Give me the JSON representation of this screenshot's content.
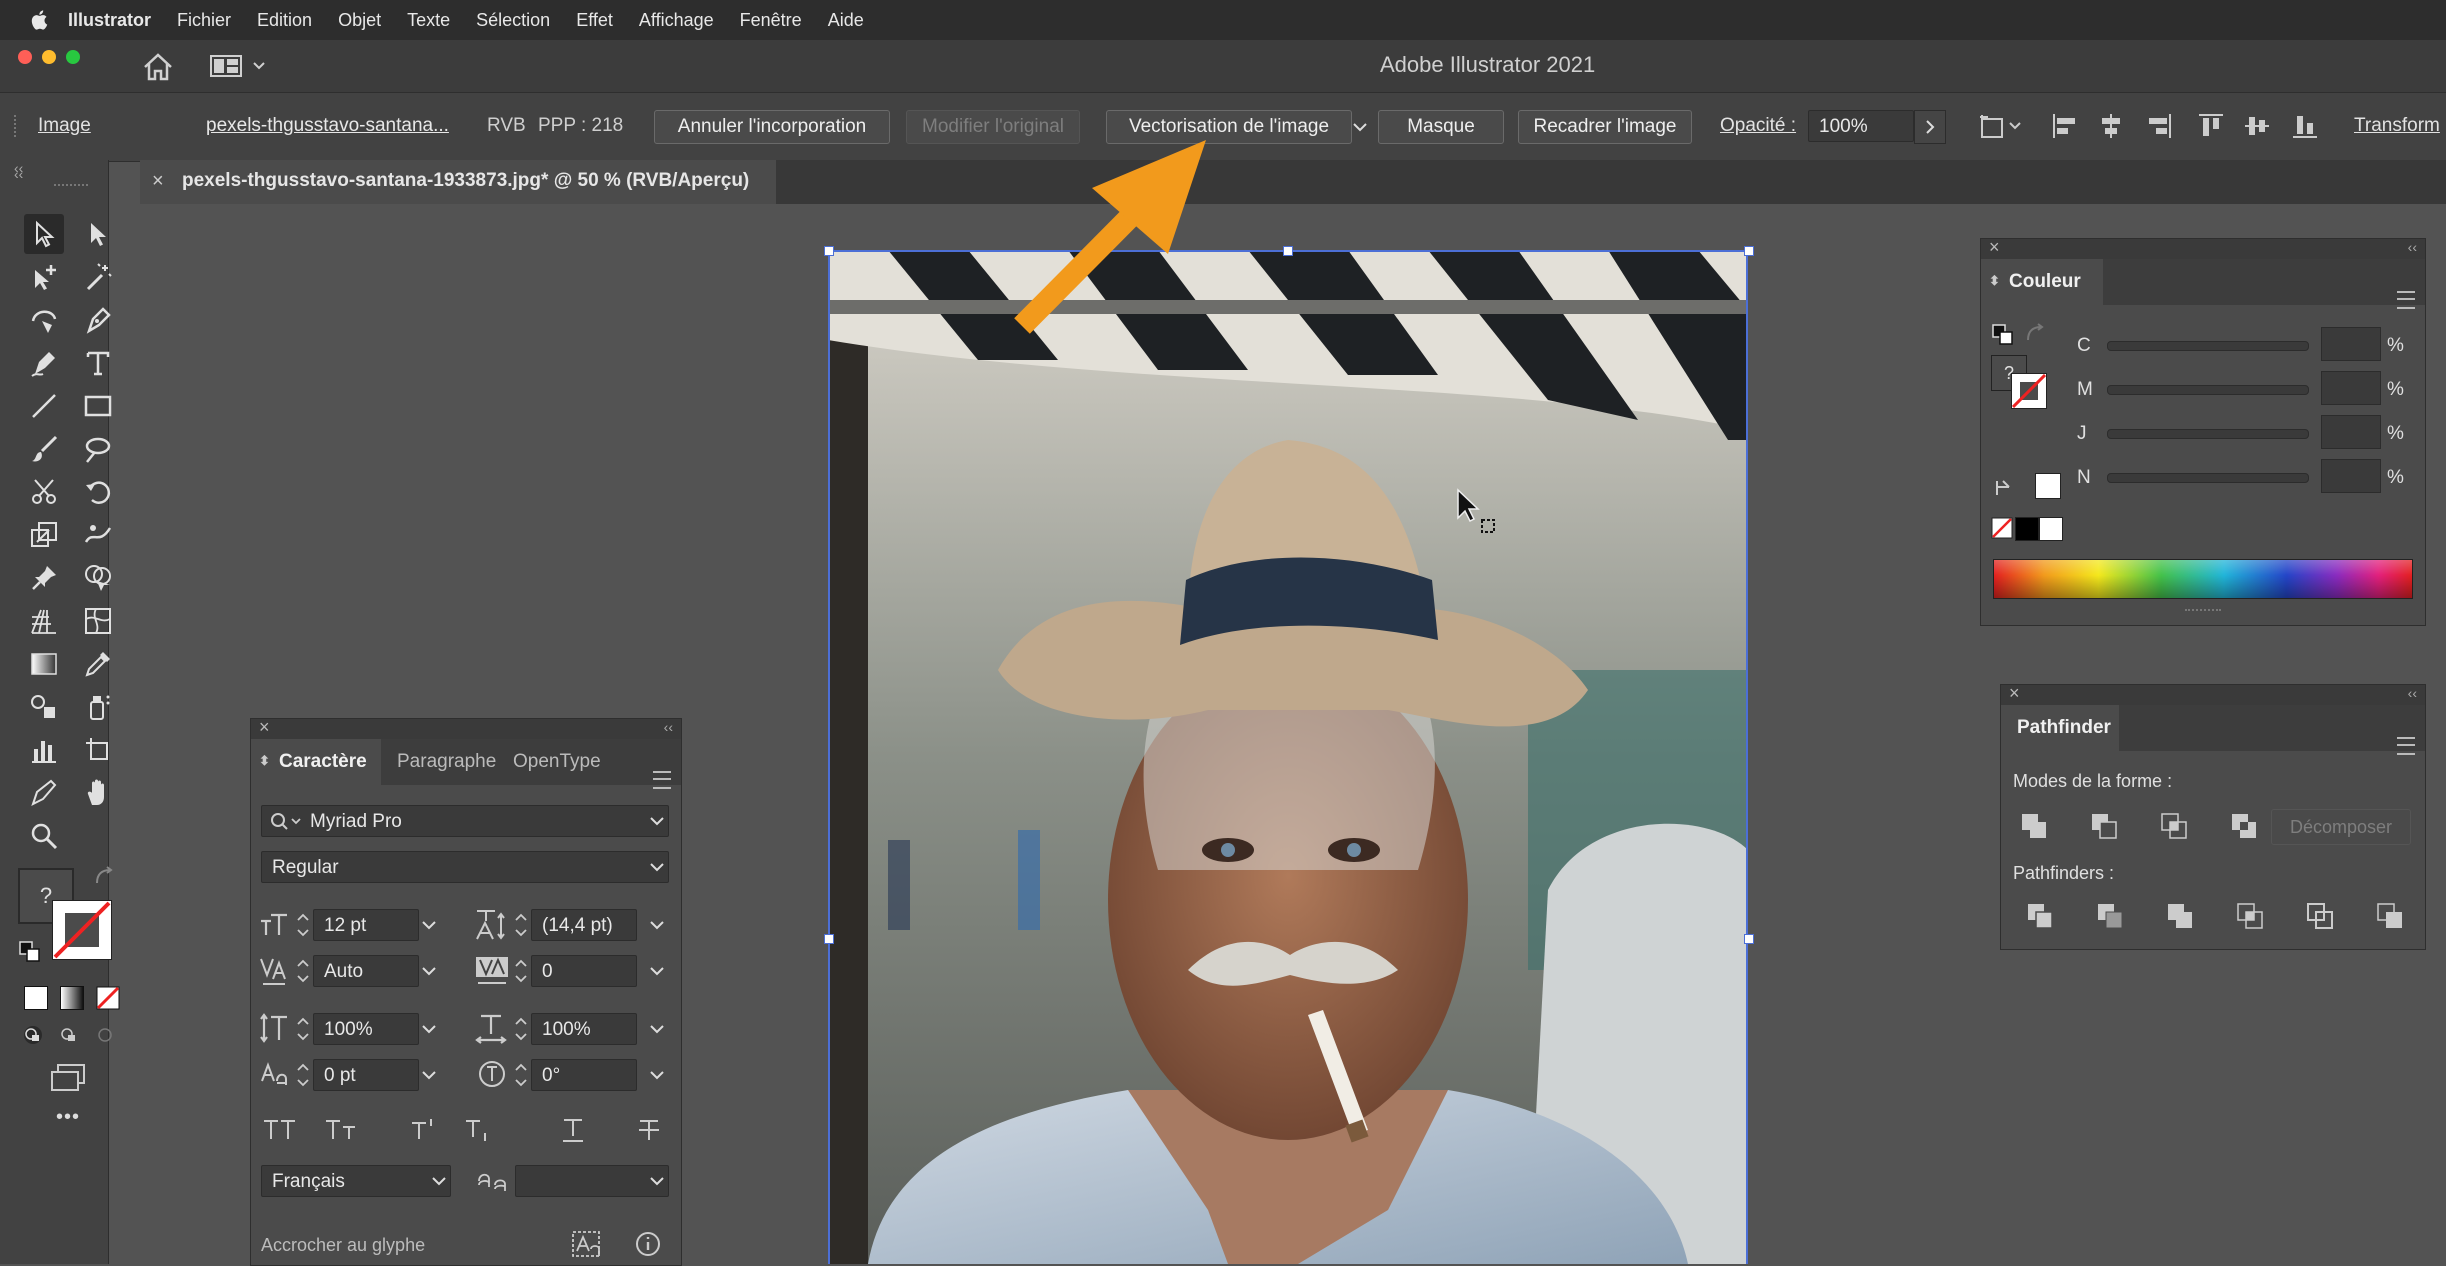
{
  "menubar": {
    "items": [
      "Illustrator",
      "Fichier",
      "Edition",
      "Objet",
      "Texte",
      "Sélection",
      "Effet",
      "Affichage",
      "Fenêtre",
      "Aide"
    ]
  },
  "window": {
    "title": "Adobe Illustrator 2021"
  },
  "controlbar": {
    "object_type": "Image",
    "filename": "pexels-thgusstavo-santana...",
    "color_mode": "RVB",
    "ppp": "PPP : 218",
    "unembed_label": "Annuler l'incorporation",
    "edit_original_label": "Modifier l'original",
    "image_trace_label": "Vectorisation de l'image",
    "mask_label": "Masque",
    "crop_label": "Recadrer l'image",
    "opacity_label": "Opacité :",
    "opacity_value": "100%",
    "transform_label": "Transform"
  },
  "document_tab": {
    "title": "pexels-thgusstavo-santana-1933873.jpg* @ 50 % (RVB/Aperçu)"
  },
  "toolbar": {
    "fill_unknown": "?",
    "more": "•••"
  },
  "character_panel": {
    "tabs": [
      "Caractère",
      "Paragraphe",
      "OpenType"
    ],
    "font_family": "Myriad Pro",
    "font_style": "Regular",
    "font_size": "12 pt",
    "leading": "(14,4 pt)",
    "kerning": "Auto",
    "tracking": "0",
    "vertical_scale": "100%",
    "horizontal_scale": "100%",
    "baseline_shift": "0 pt",
    "rotation": "0°",
    "language": "Français",
    "snap_label": "Accrocher au glyphe"
  },
  "color_panel": {
    "title": "Couleur",
    "fill_unknown": "?",
    "channels": [
      "C",
      "M",
      "J",
      "N"
    ],
    "unit": "%"
  },
  "pathfinder_panel": {
    "title": "Pathfinder",
    "shape_modes_label": "Modes de la forme :",
    "expand_label": "Décomposer",
    "pathfinders_label": "Pathfinders :"
  },
  "colors": {
    "accent_arrow": "#f29a1c",
    "selection_blue": "#4c6fd6"
  }
}
